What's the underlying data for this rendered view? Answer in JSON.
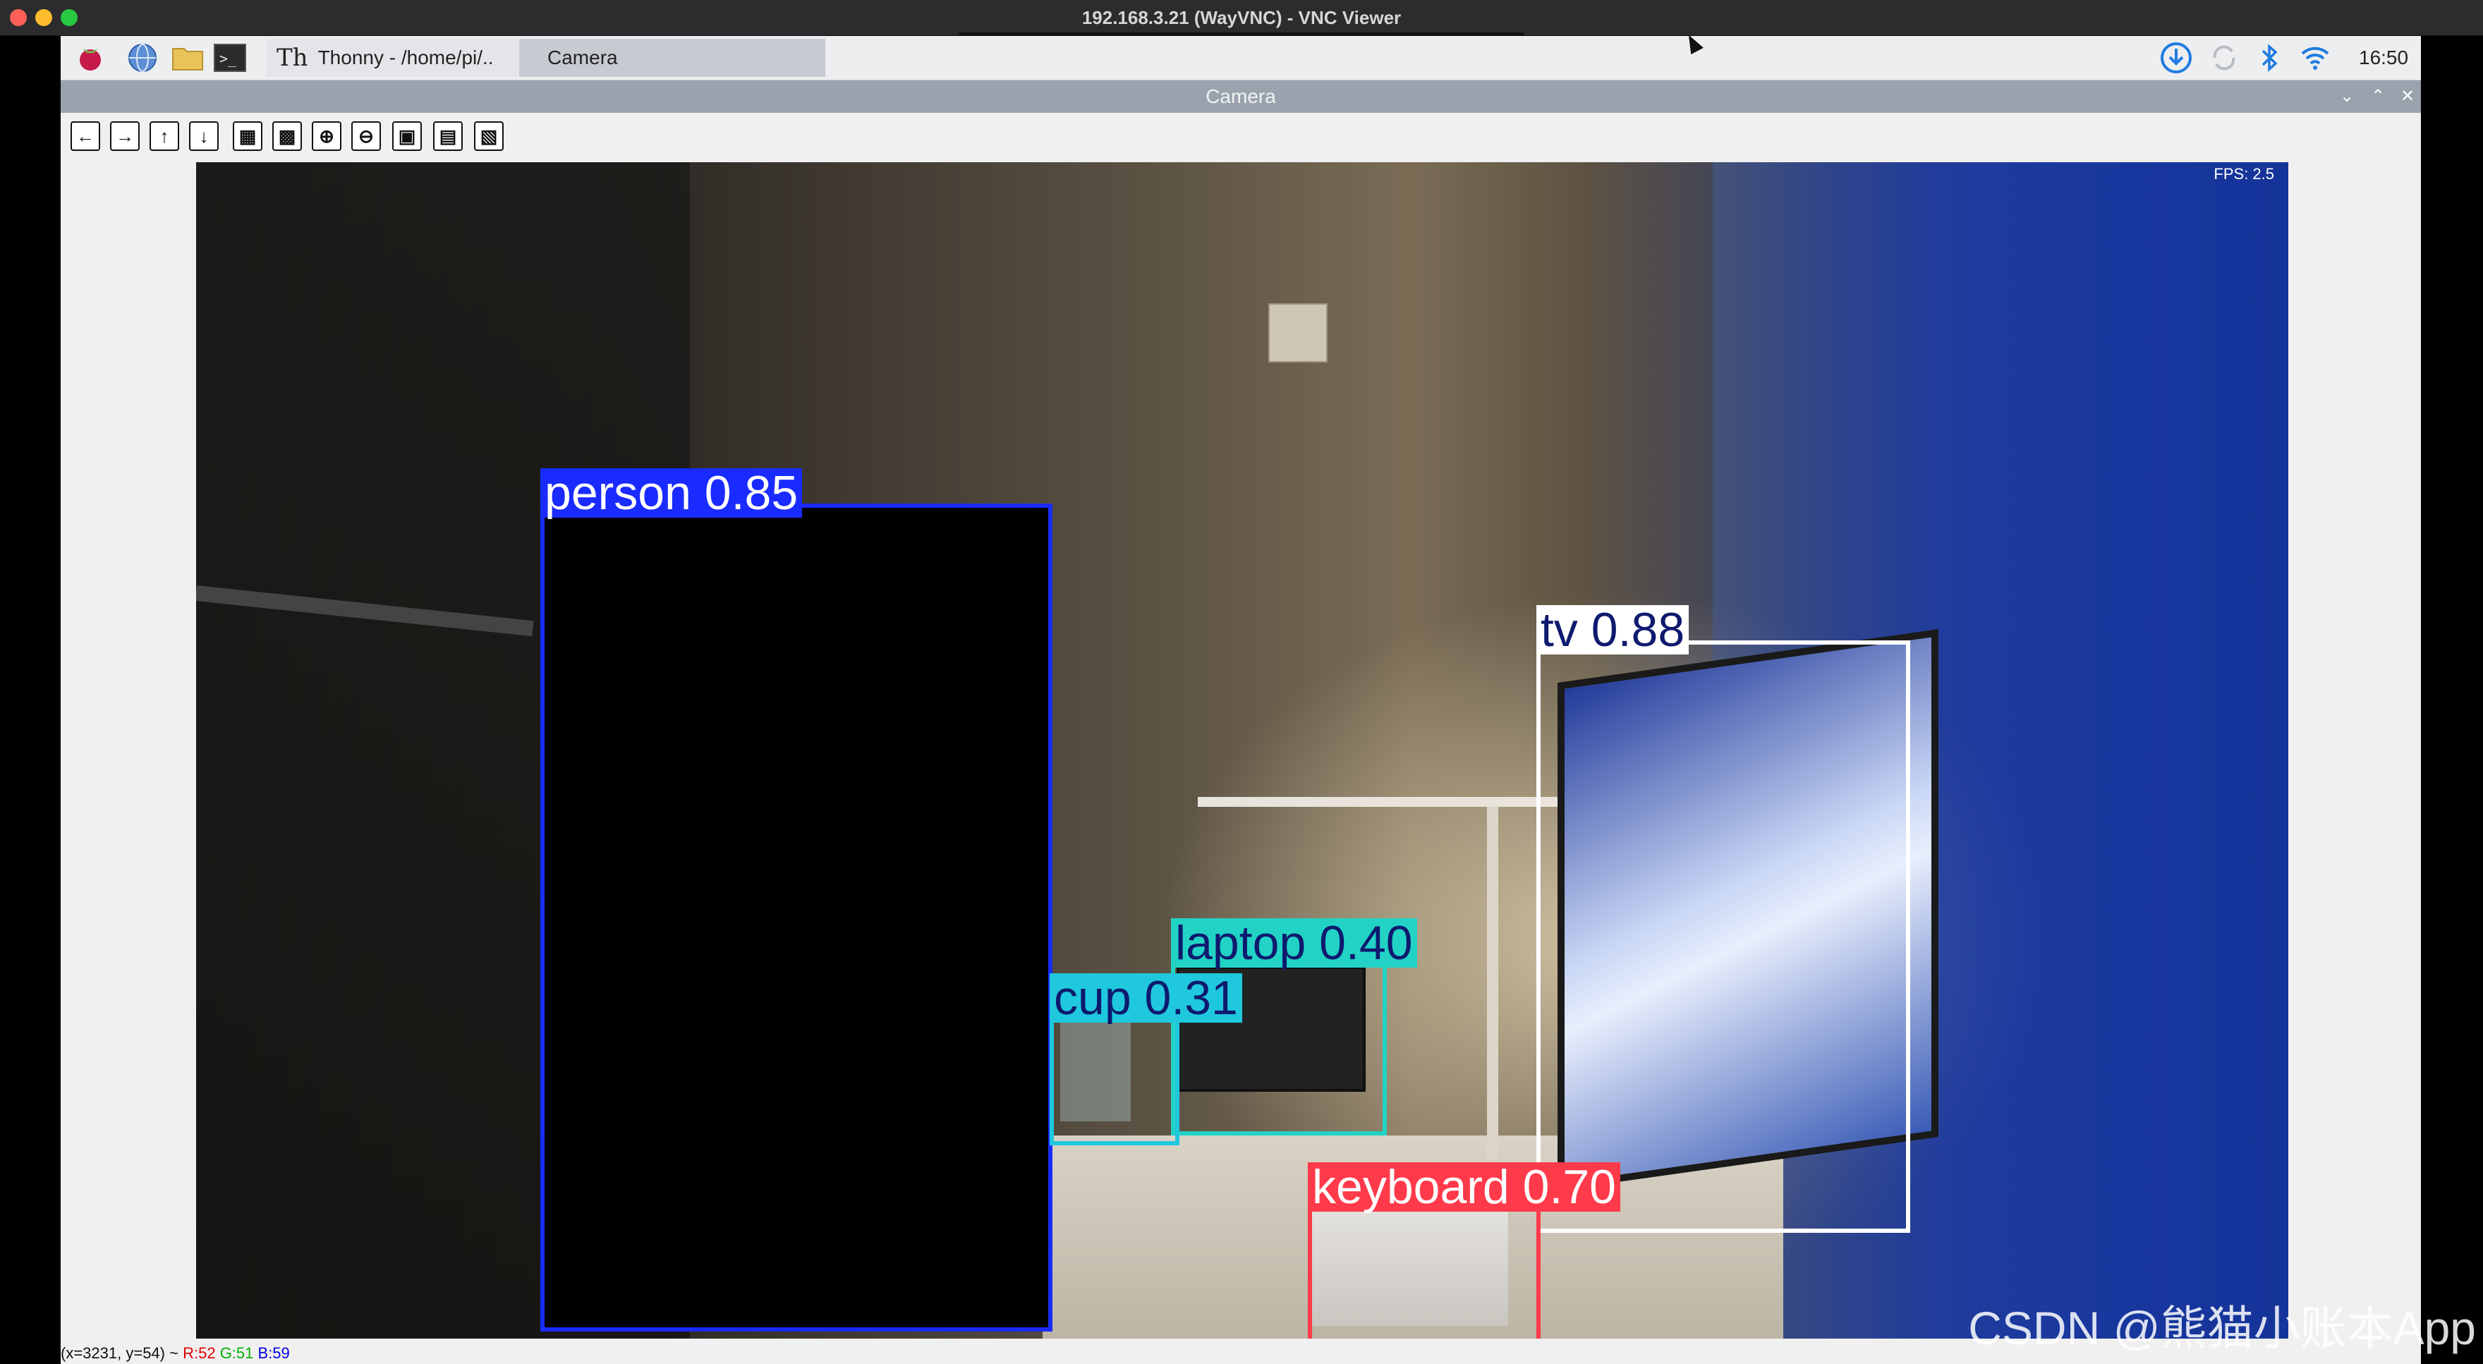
{
  "window": {
    "title": "192.168.3.21 (WayVNC) - VNC Viewer"
  },
  "taskbar": {
    "tasks": [
      {
        "label": "Thonny  -  /home/pi/.."
      },
      {
        "label": "Camera"
      }
    ],
    "clock": "16:50"
  },
  "camera_window": {
    "title": "Camera",
    "controls": [
      "minimize",
      "maximize",
      "close"
    ],
    "toolbar": [
      "back",
      "forward",
      "up",
      "down",
      "image",
      "image-alt",
      "zoom-in",
      "zoom-out",
      "save",
      "clipboard",
      "copy"
    ]
  },
  "image": {
    "fps": "FPS: 2.5",
    "detections": [
      {
        "label": "person  0.85",
        "color": "#1a2bff",
        "text_color": "#ffffff"
      },
      {
        "label": "tv  0.88",
        "color": "#ffffff",
        "text_color": "#0e1a6e"
      },
      {
        "label": "laptop  0.40",
        "color": "#22d3c5",
        "text_color": "#0e1a6e"
      },
      {
        "label": "cup  0.31",
        "color": "#1fc8dd",
        "text_color": "#0e1a6e"
      },
      {
        "label": "keyboard  0.70",
        "color": "#ff3a4a",
        "text_color": "#ffffff"
      }
    ]
  },
  "status_bar": {
    "coords": "(x=3231, y=54) ~",
    "r": "R:52",
    "g": "G:51",
    "b": "B:59"
  },
  "watermark": "CSDN @熊猫小账本App"
}
